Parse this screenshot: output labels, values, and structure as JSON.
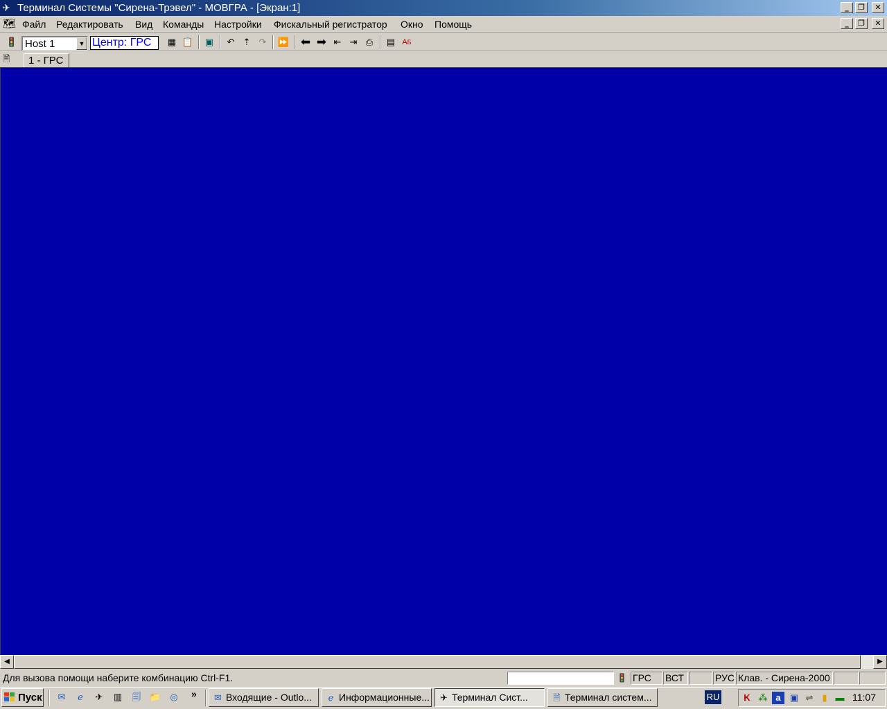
{
  "window": {
    "title": "Терминал Системы \"Сирена-Трэвел\" - МОВГРА - [Экран:1]",
    "caption_buttons": [
      "_",
      "❐",
      "✕"
    ]
  },
  "menu": {
    "items": [
      "Файл",
      "Редактировать",
      "Вид",
      "Команды",
      "Настройки",
      "Фискальный регистратор",
      "Окно",
      "Помощь"
    ]
  },
  "toolbar": {
    "host_value": "Host 1",
    "center_label": "Центр: ГРС"
  },
  "tabs": {
    "active": "1 - ГРС"
  },
  "statusbar": {
    "help_text": "Для вызова помощи наберите комбинацию Ctrl-F1.",
    "input_value": "",
    "center": "ГРС",
    "mode": "ВСТ",
    "empty1": "",
    "lang": "РУС",
    "keyboard": "Клав. - Сирена-2000",
    "empty2": "",
    "empty3": ""
  },
  "taskbar": {
    "start_label": "Пуск",
    "overflow": "»",
    "buttons": [
      "Входящие - Outlo...",
      "Информационные...",
      "Терминал Сист...",
      "Терминал систем..."
    ],
    "active_index": 2,
    "lang_indicator": "RU",
    "clock": "11:07"
  },
  "colors": {
    "terminal_bg": "#0000a8",
    "title_start": "#0a246a",
    "title_end": "#a6caf0",
    "center_text": "#0000ff"
  }
}
